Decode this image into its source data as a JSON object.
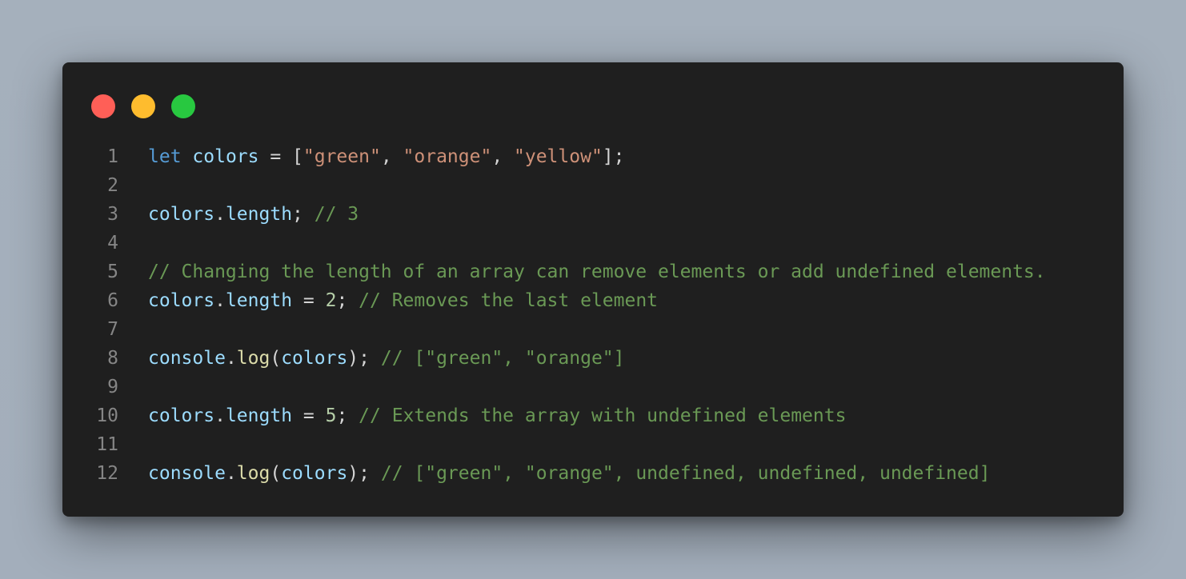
{
  "colors": {
    "close": "#ff5f57",
    "minimize": "#febc2e",
    "zoom": "#28c840",
    "keyword": "#569cd6",
    "variable": "#9cdcfe",
    "string": "#ce9178",
    "number": "#b5cea8",
    "function": "#dcdcaa",
    "comment": "#6a9955",
    "punctuation": "#d4d4d4",
    "line_number": "#858585",
    "editor_bg": "#1f1f1f"
  },
  "lines": [
    {
      "num": "1",
      "tokens": [
        {
          "t": "let",
          "c": "kw"
        },
        {
          "t": " ",
          "c": "pn"
        },
        {
          "t": "colors",
          "c": "var"
        },
        {
          "t": " = [",
          "c": "pn"
        },
        {
          "t": "\"green\"",
          "c": "str"
        },
        {
          "t": ", ",
          "c": "pn"
        },
        {
          "t": "\"orange\"",
          "c": "str"
        },
        {
          "t": ", ",
          "c": "pn"
        },
        {
          "t": "\"yellow\"",
          "c": "str"
        },
        {
          "t": "];",
          "c": "pn"
        }
      ]
    },
    {
      "num": "2",
      "tokens": []
    },
    {
      "num": "3",
      "tokens": [
        {
          "t": "colors",
          "c": "var"
        },
        {
          "t": ".",
          "c": "pn"
        },
        {
          "t": "length",
          "c": "var"
        },
        {
          "t": "; ",
          "c": "pn"
        },
        {
          "t": "// 3",
          "c": "cm"
        }
      ]
    },
    {
      "num": "4",
      "tokens": []
    },
    {
      "num": "5",
      "tokens": [
        {
          "t": "// Changing the length of an array can remove elements or add undefined elements.",
          "c": "cm"
        }
      ]
    },
    {
      "num": "6",
      "tokens": [
        {
          "t": "colors",
          "c": "var"
        },
        {
          "t": ".",
          "c": "pn"
        },
        {
          "t": "length",
          "c": "var"
        },
        {
          "t": " = ",
          "c": "pn"
        },
        {
          "t": "2",
          "c": "num"
        },
        {
          "t": "; ",
          "c": "pn"
        },
        {
          "t": "// Removes the last element",
          "c": "cm"
        }
      ]
    },
    {
      "num": "7",
      "tokens": []
    },
    {
      "num": "8",
      "tokens": [
        {
          "t": "console",
          "c": "var"
        },
        {
          "t": ".",
          "c": "pn"
        },
        {
          "t": "log",
          "c": "fn"
        },
        {
          "t": "(",
          "c": "pn"
        },
        {
          "t": "colors",
          "c": "var"
        },
        {
          "t": "); ",
          "c": "pn"
        },
        {
          "t": "// [\"green\", \"orange\"]",
          "c": "cm"
        }
      ]
    },
    {
      "num": "9",
      "tokens": []
    },
    {
      "num": "10",
      "tokens": [
        {
          "t": "colors",
          "c": "var"
        },
        {
          "t": ".",
          "c": "pn"
        },
        {
          "t": "length",
          "c": "var"
        },
        {
          "t": " = ",
          "c": "pn"
        },
        {
          "t": "5",
          "c": "num"
        },
        {
          "t": "; ",
          "c": "pn"
        },
        {
          "t": "// Extends the array with undefined elements",
          "c": "cm"
        }
      ]
    },
    {
      "num": "11",
      "tokens": []
    },
    {
      "num": "12",
      "tokens": [
        {
          "t": "console",
          "c": "var"
        },
        {
          "t": ".",
          "c": "pn"
        },
        {
          "t": "log",
          "c": "fn"
        },
        {
          "t": "(",
          "c": "pn"
        },
        {
          "t": "colors",
          "c": "var"
        },
        {
          "t": "); ",
          "c": "pn"
        },
        {
          "t": "// [\"green\", \"orange\", undefined, undefined, undefined]",
          "c": "cm"
        }
      ]
    }
  ]
}
